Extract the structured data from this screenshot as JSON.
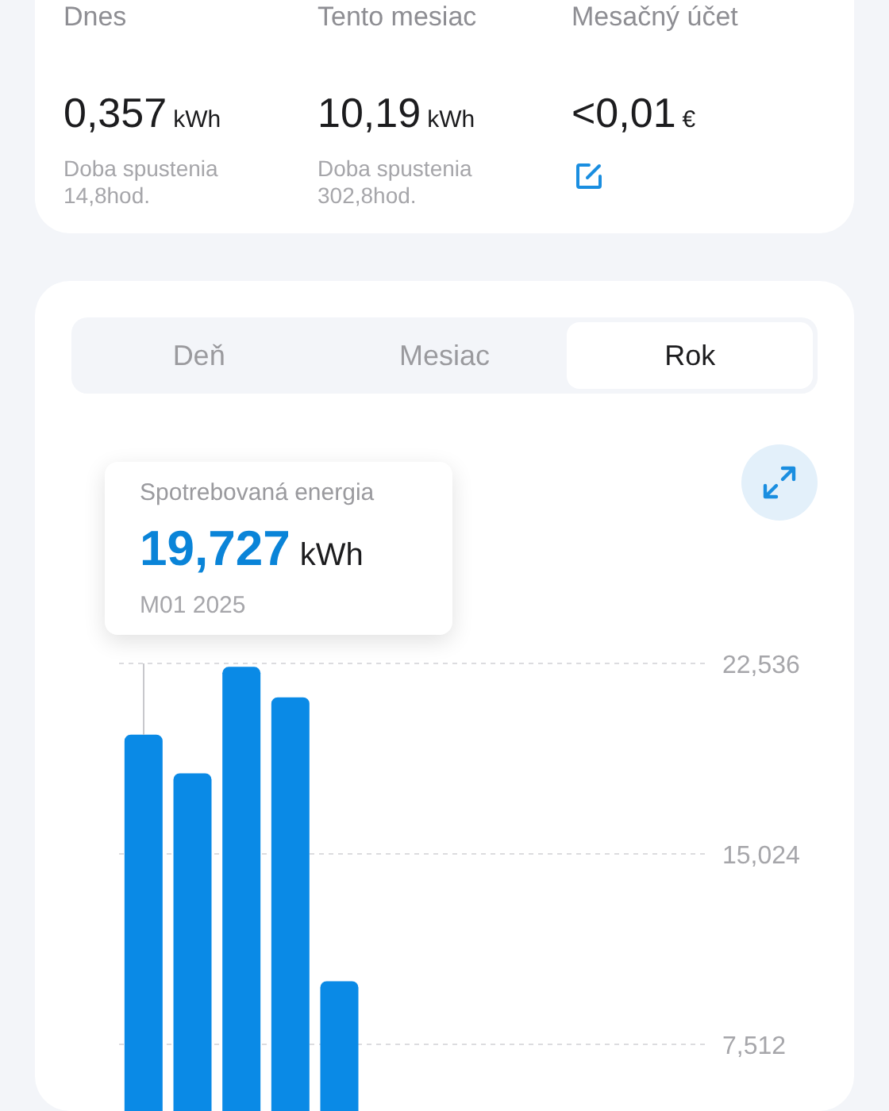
{
  "summary": [
    {
      "kind": "energy",
      "label": "Dnes",
      "value": "0,357",
      "unit": "kWh",
      "runtime_label": "Doba spustenia",
      "runtime": "14,8hod."
    },
    {
      "kind": "energy",
      "label": "Tento mesiac",
      "value": "10,19",
      "unit": "kWh",
      "runtime_label": "Doba spustenia",
      "runtime": "302,8hod."
    },
    {
      "kind": "bill",
      "label": "Mesačný účet",
      "value": "<0,01",
      "unit": "€"
    }
  ],
  "tabs": [
    {
      "label": "Deň",
      "selected": false
    },
    {
      "label": "Mesiac",
      "selected": false
    },
    {
      "label": "Rok",
      "selected": true
    }
  ],
  "chart": {
    "tooltip": {
      "title": "Spotrebovaná energia",
      "value": "19,727",
      "unit": "kWh",
      "period": "M01 2025"
    },
    "chart_data": {
      "type": "bar",
      "ylim": [
        0,
        22.536
      ],
      "yticks": [
        {
          "value": 7.512,
          "label": "7,512"
        },
        {
          "value": 15.024,
          "label": "15,024"
        },
        {
          "value": 22.536,
          "label": "22,536"
        }
      ],
      "series": [
        {
          "color": "#0a8ae6",
          "values": [
            19.727,
            18.2,
            22.4,
            21.2,
            10.0,
            null,
            null,
            null,
            null,
            null,
            null,
            null
          ]
        }
      ]
    }
  }
}
